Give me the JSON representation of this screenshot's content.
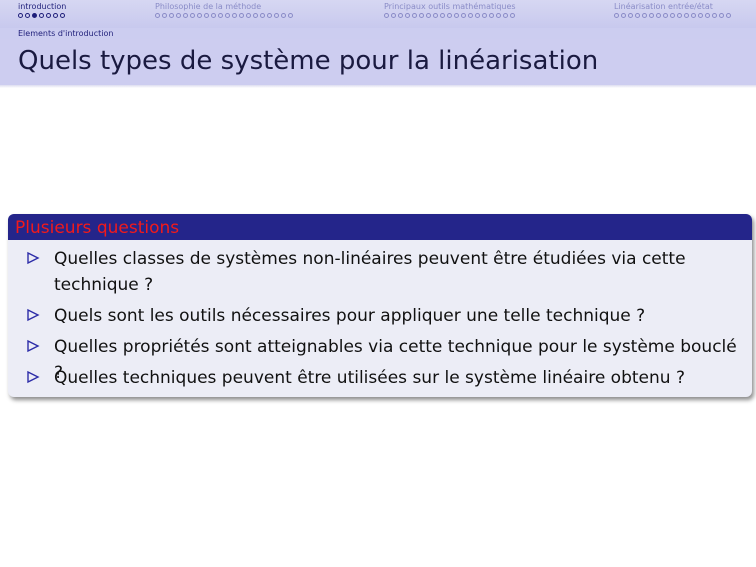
{
  "nav": {
    "sections": [
      {
        "title": "introduction",
        "dots": 7,
        "current": 2,
        "active": true
      },
      {
        "title": "Philosophie de la méthode",
        "dots": 20,
        "current": -1,
        "active": false
      },
      {
        "title": "Principaux outils mathématiques",
        "dots": 19,
        "current": -1,
        "active": false
      },
      {
        "title": "Linéarisation entrée/état",
        "dots": 17,
        "current": -1,
        "active": false
      }
    ]
  },
  "subsection": "Elements d'introduction",
  "frame_title": "Quels types de système pour la linéarisation",
  "block": {
    "title": "Plusieurs questions",
    "items": [
      "Quelles classes de systèmes non-linéaires peuvent être étudiées via cette technique ?",
      "Quels sont les outils nécessaires pour appliquer une telle technique ?",
      "Quelles propriétés sont atteignables via cette technique pour le système bouclé ?",
      "Quelles techniques peuvent être utilisées sur le système linéaire obtenu ?"
    ]
  },
  "colors": {
    "nav_background": "#c8c9ee",
    "block_header": "#24258a",
    "block_title": "#f21a1a",
    "block_body": "#ecedf6",
    "bullet": "#2d2da8"
  }
}
